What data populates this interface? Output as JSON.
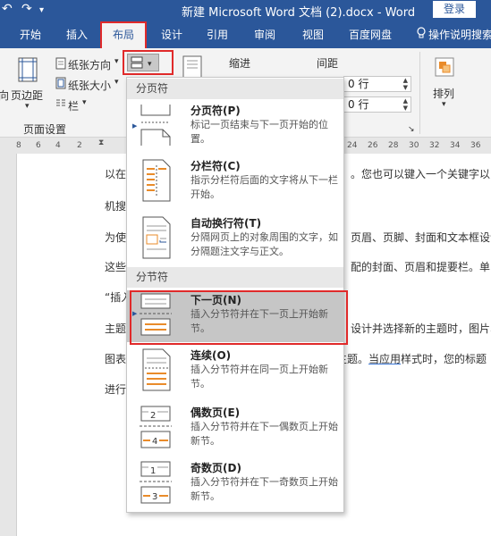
{
  "titlebar": {
    "undo_icon": "undo-icon",
    "redo_icon": "redo-icon",
    "title": "新建 Microsoft Word 文档 (2).docx  -  Word",
    "login": "登录"
  },
  "tabs": [
    {
      "label": "开始"
    },
    {
      "label": "插入"
    },
    {
      "label": "布局",
      "active": true
    },
    {
      "label": "设计"
    },
    {
      "label": "引用"
    },
    {
      "label": "审阅"
    },
    {
      "label": "视图"
    },
    {
      "label": "百度网盘"
    },
    {
      "label": "操作说明搜索",
      "icon": "lightbulb-icon"
    }
  ],
  "ribbon": {
    "orientation": "纸张方向",
    "size": "纸张大小",
    "columns": "栏",
    "margins": "页边距",
    "direction_partial": "向",
    "group_page_setup": "页面设置",
    "indent_label": "缩进",
    "spacing_label": "间距",
    "spacing_before": "0 行",
    "spacing_after": "0 行",
    "arrange": "排列"
  },
  "ruler": {
    "left_ticks": [
      "8",
      "6",
      "4",
      "2"
    ],
    "right_ticks": [
      "24",
      "26",
      "28",
      "30",
      "32",
      "34",
      "36"
    ]
  },
  "document": {
    "lines": [
      {
        "left": "以在",
        "right": "。您也可以键入一个关键字以"
      },
      {
        "left": "机搜",
        "right": ""
      },
      {
        "left": "为使",
        "right": "页眉、页脚、封面和文本框设计"
      },
      {
        "left": "这些",
        "right": "配的封面、页眉和提要栏。单"
      },
      {
        "left": "“插入",
        "right": ""
      },
      {
        "left": "主题",
        "right": "设计并选择新的主题时，图片、"
      },
      {
        "left": "图表",
        "right_pre": "主题。",
        "right_underline": "当应用",
        "right_post": "样式时，您的标题"
      },
      {
        "left": "进行",
        "right": ""
      }
    ]
  },
  "menu": {
    "section_page_breaks": "分页符",
    "section_section_breaks": "分节符",
    "items": [
      {
        "title": "分页符(P)",
        "desc": "标记一页结束与下一页开始的位置。",
        "icon": "page-break-icon"
      },
      {
        "title": "分栏符(C)",
        "desc": "指示分栏符后面的文字将从下一栏开始。",
        "icon": "column-break-icon"
      },
      {
        "title": "自动换行符(T)",
        "desc": "分隔网页上的对象周围的文字，如分隔题注文字与正文。",
        "icon": "text-wrapping-break-icon"
      },
      {
        "title": "下一页(N)",
        "desc": "插入分节符并在下一页上开始新节。",
        "icon": "next-page-section-icon",
        "selected": true
      },
      {
        "title": "连续(O)",
        "desc": "插入分节符并在同一页上开始新节。",
        "icon": "continuous-section-icon"
      },
      {
        "title": "偶数页(E)",
        "desc": "插入分节符并在下一偶数页上开始新节。",
        "icon": "even-page-section-icon"
      },
      {
        "title": "奇数页(D)",
        "desc": "插入分节符并在下一奇数页上开始新节。",
        "icon": "odd-page-section-icon"
      }
    ]
  },
  "colors": {
    "accent": "#2b579a",
    "highlight_border": "#e02a2a",
    "selected_bg": "#c6c6c6",
    "icon_orange": "#e98b2a"
  }
}
